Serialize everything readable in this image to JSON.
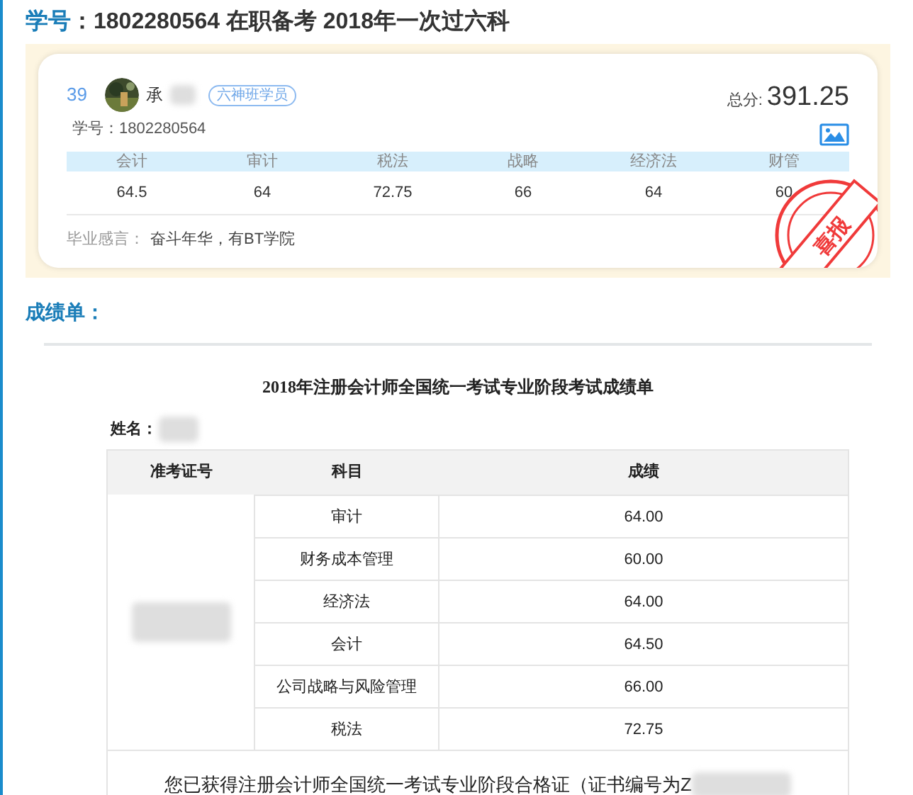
{
  "heading": {
    "label": "学号",
    "text": "：1802280564 在职备考 2018年一次过六科"
  },
  "card": {
    "rank": "39",
    "name": "承",
    "badge": "六神班学员",
    "student_id": "学号：1802280564",
    "total_label": "总分:",
    "total": "391.25",
    "scores": [
      {
        "subject": "会计",
        "score": "64.5"
      },
      {
        "subject": "审计",
        "score": "64"
      },
      {
        "subject": "税法",
        "score": "72.75"
      },
      {
        "subject": "战略",
        "score": "66"
      },
      {
        "subject": "经济法",
        "score": "64"
      },
      {
        "subject": "财管",
        "score": "60"
      }
    ],
    "motto_label": "毕业感言：",
    "motto": "奋斗年华，有BT学院",
    "stamp": "喜报"
  },
  "section_title": "成绩单：",
  "report": {
    "title": "2018年注册会计师全国统一考试专业阶段考试成绩单",
    "name_label": "姓名：",
    "columns": [
      "准考证号",
      "科目",
      "成绩"
    ],
    "rows": [
      {
        "subject": "审计",
        "score": "64.00"
      },
      {
        "subject": "财务成本管理",
        "score": "60.00"
      },
      {
        "subject": "经济法",
        "score": "64.00"
      },
      {
        "subject": "会计",
        "score": "64.50"
      },
      {
        "subject": "公司战略与风险管理",
        "score": "66.00"
      },
      {
        "subject": "税法",
        "score": "72.75"
      }
    ],
    "footer": "您已获得注册会计师全国统一考试专业阶段合格证（证书编号为Z"
  }
}
